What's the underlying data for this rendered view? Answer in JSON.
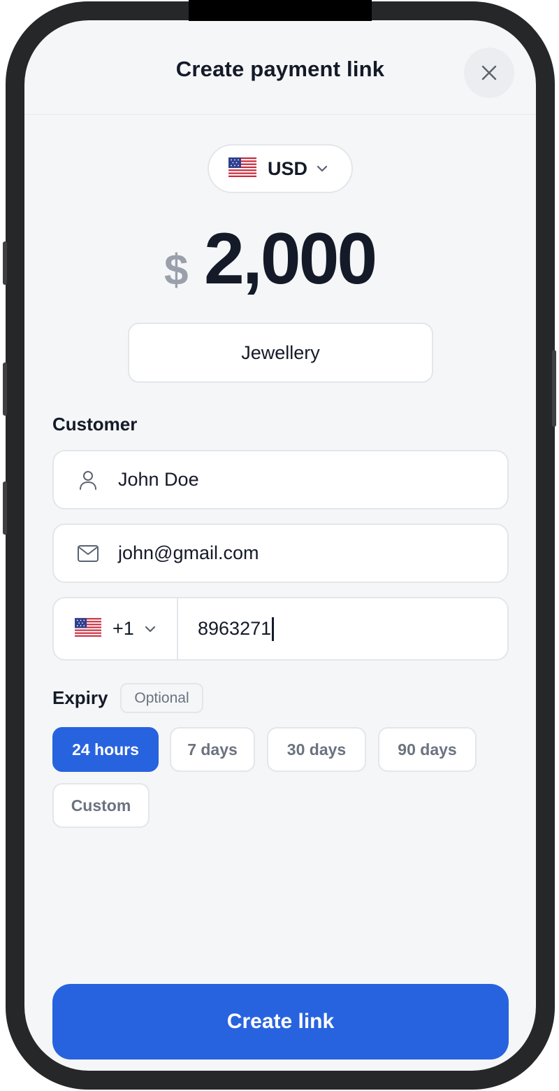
{
  "header": {
    "title": "Create payment link",
    "close_icon": "close-icon"
  },
  "currency": {
    "flag": "us-flag-icon",
    "code": "USD"
  },
  "amount": {
    "symbol": "$",
    "value": "2,000"
  },
  "description": {
    "value": "Jewellery"
  },
  "customer": {
    "label": "Customer",
    "name": "John Doe",
    "email": "john@gmail.com",
    "phone": {
      "country_code": "+1",
      "number": "8963271"
    }
  },
  "expiry": {
    "label": "Expiry",
    "optional_badge": "Optional",
    "options": [
      "24 hours",
      "7 days",
      "30 days",
      "90 days",
      "Custom"
    ],
    "selected": "24 hours"
  },
  "actions": {
    "create_label": "Create link"
  },
  "colors": {
    "accent": "#2863df",
    "background": "#f5f6f8",
    "text": "#141a28",
    "muted": "#6b7280"
  }
}
